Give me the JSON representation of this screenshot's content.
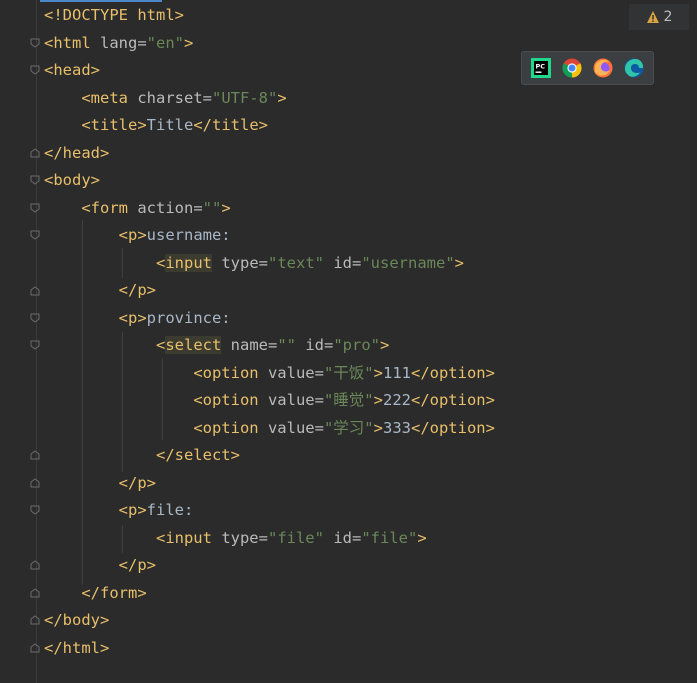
{
  "inspection": {
    "warning_count": "2"
  },
  "browsers": [
    "pycharm-icon",
    "chrome-icon",
    "firefox-icon",
    "edge-icon"
  ],
  "code": {
    "l1": {
      "tag_open": "<!DOCTYPE html>"
    },
    "l2": {
      "p1": "<html ",
      "a1": "lang=",
      "v1": "\"en\"",
      "p2": ">"
    },
    "l3": {
      "p1": "<head>"
    },
    "l4": {
      "p1": "<meta ",
      "a1": "charset=",
      "v1": "\"UTF-8\"",
      "p2": ">"
    },
    "l5": {
      "p1": "<title>",
      "t1": "Title",
      "p2": "</title>"
    },
    "l6": {
      "p1": "</head>"
    },
    "l7": {
      "p1": "<body>"
    },
    "l8": {
      "p1": "<form ",
      "a1": "action=",
      "v1": "\"\"",
      "p2": ">"
    },
    "l9": {
      "p1": "<p>",
      "t1": "username:"
    },
    "l10": {
      "p1": "<",
      "hl": "input",
      "p2": " ",
      "a1": "type=",
      "v1": "\"text\"",
      "a2": " id=",
      "v2": "\"username\"",
      "p3": ">"
    },
    "l11": {
      "p1": "</p>"
    },
    "l12": {
      "p1": "<p>",
      "t1": "province:"
    },
    "l13": {
      "p1": "<",
      "hl": "select",
      "p2": " ",
      "a1": "name=",
      "v1": "\"\"",
      "a2": " id=",
      "v2": "\"pro\"",
      "p3": ">"
    },
    "l14": {
      "p1": "<option ",
      "a1": "value=",
      "v1": "\"干饭\"",
      "p2": ">",
      "t1": "111",
      "p3": "</option>"
    },
    "l15": {
      "p1": "<option ",
      "a1": "value=",
      "v1": "\"睡觉\"",
      "p2": ">",
      "t1": "222",
      "p3": "</option>"
    },
    "l16": {
      "p1": "<option ",
      "a1": "value=",
      "v1": "\"学习\"",
      "p2": ">",
      "t1": "333",
      "p3": "</option>"
    },
    "l17": {
      "p1": "</select>"
    },
    "l18": {
      "p1": "</p>"
    },
    "l19": {
      "p1": "<p>",
      "t1": "file:"
    },
    "l20": {
      "p1": "<input ",
      "a1": "type=",
      "v1": "\"file\"",
      "a2": " id=",
      "v2": "\"file\"",
      "p2": ">"
    },
    "l21": {
      "p1": "</p>"
    },
    "l22": {
      "p1": "</form>"
    },
    "l23": {
      "p1": "</body>"
    },
    "l24": {
      "p1": "</html>"
    }
  }
}
